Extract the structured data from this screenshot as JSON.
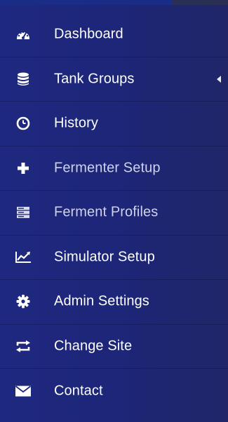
{
  "sidebar": {
    "items": [
      {
        "label": "Dashboard",
        "icon": "dashboard-icon"
      },
      {
        "label": "Tank Groups",
        "icon": "database-icon",
        "has_submenu": true
      },
      {
        "label": "History",
        "icon": "clock-icon"
      },
      {
        "label": "Fermenter Setup",
        "icon": "plus-icon"
      },
      {
        "label": "Ferment Profiles",
        "icon": "server-icon"
      },
      {
        "label": "Simulator Setup",
        "icon": "line-chart-icon"
      },
      {
        "label": "Admin Settings",
        "icon": "gear-icon"
      },
      {
        "label": "Change Site",
        "icon": "retweet-icon"
      },
      {
        "label": "Contact",
        "icon": "envelope-icon"
      }
    ]
  },
  "colors": {
    "background": "#1e2880",
    "text": "#ffffff",
    "dim_text": "#cfd2ea"
  }
}
